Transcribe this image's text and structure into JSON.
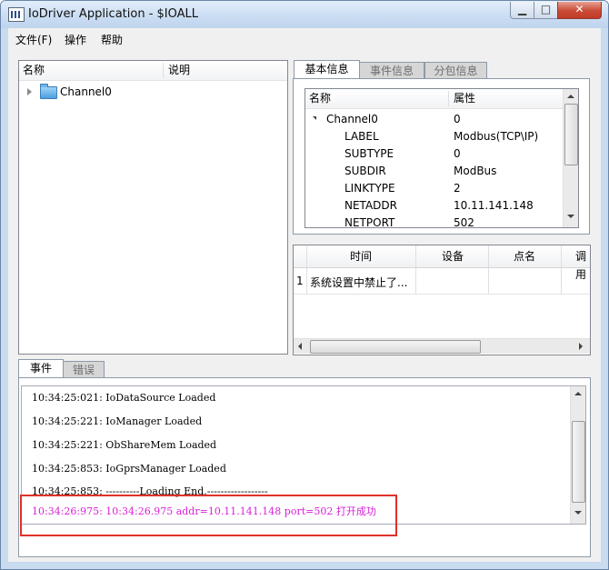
{
  "window": {
    "title": "IoDriver Application - $IOALL",
    "min_glyph": "▁",
    "max_glyph": "□",
    "close_glyph": "✕"
  },
  "menu": [
    "文件(F)",
    "操作",
    "帮助"
  ],
  "tree": {
    "columns": [
      "名称",
      "说明"
    ],
    "items": [
      {
        "label": "Channel0",
        "icon": "folder-icon",
        "expanded": false
      }
    ]
  },
  "props_tabs": [
    "基本信息",
    "事件信息",
    "分包信息"
  ],
  "props": {
    "columns": [
      "名称",
      "属性"
    ],
    "rows": [
      {
        "name": "Channel0",
        "value": "0",
        "group": true
      },
      {
        "name": "LABEL",
        "value": "Modbus(TCP\\IP)"
      },
      {
        "name": "SUBTYPE",
        "value": "0"
      },
      {
        "name": "SUBDIR",
        "value": "ModBus"
      },
      {
        "name": "LINKTYPE",
        "value": "2"
      },
      {
        "name": "NETADDR",
        "value": "10.11.141.148"
      },
      {
        "name": "NETPORT",
        "value": "502"
      }
    ]
  },
  "events_grid": {
    "columns": [
      "时间",
      "设备",
      "点名",
      "调用"
    ],
    "rows": [
      {
        "num": "1",
        "time": "系统设置中禁止了...",
        "device": "",
        "point": "",
        "call": ""
      }
    ]
  },
  "log_tabs": [
    "事件",
    "错误"
  ],
  "log": [
    {
      "text": "10:34:25:021: IoDataSource Loaded",
      "color": "#000000"
    },
    {
      "text": "10:34:25:221: IoManager Loaded",
      "color": "#000000"
    },
    {
      "text": "10:34:25:221: ObShareMem Loaded",
      "color": "#000000"
    },
    {
      "text": "10:34:25:853: IoGprsManager Loaded",
      "color": "#000000"
    },
    {
      "text": "10:34:25:853: ----------Loading End.------------------",
      "color": "#000000"
    },
    {
      "text": "10:34:26:975: 10:34:26.975 addr=10.11.141.148 port=502 打开成功",
      "color": "#d81fd8"
    }
  ],
  "colors": {
    "highlight_box": "#e0302a",
    "success_log": "#d81fd8"
  }
}
